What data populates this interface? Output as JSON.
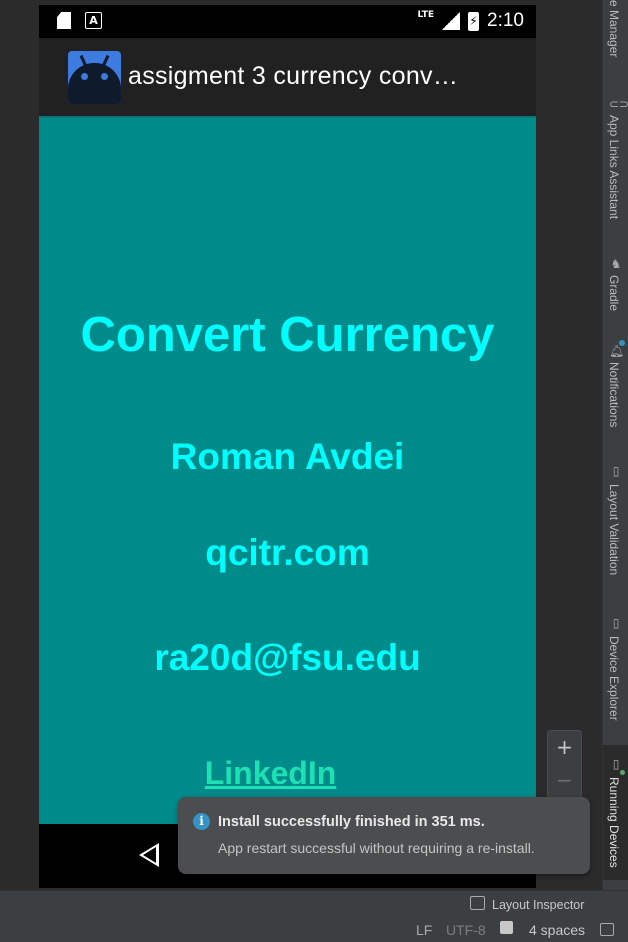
{
  "device": {
    "status_bar": {
      "network": "LTE",
      "battery_symbol": "⚡",
      "time": "2:10"
    },
    "app_bar": {
      "title": "assigment 3 currency conv…"
    },
    "content": {
      "heading": "Convert Currency",
      "name": "Roman Avdei",
      "website": "qcitr.com",
      "email": "ra20d@fsu.edu",
      "link": "LinkedIn"
    },
    "colors": {
      "content_bg": "#008b8b",
      "text": "#00ffff",
      "link": "#1de0b3"
    }
  },
  "zoom": {
    "plus": "+",
    "minus": "−"
  },
  "tool_strip": {
    "items": [
      {
        "label": "e Manager"
      },
      {
        "label": "App Links Assistant"
      },
      {
        "label": "Gradle"
      },
      {
        "label": "Notifications"
      },
      {
        "label": "Layout Validation"
      },
      {
        "label": "Device Explorer"
      },
      {
        "label": "Running Devices"
      }
    ]
  },
  "toast": {
    "icon": "i",
    "title": "Install successfully finished in 351 ms.",
    "body": "App restart successful without requiring a re-install."
  },
  "bottom": {
    "layout_inspector": "Layout Inspector",
    "line_ending": "LF",
    "encoding": "UTF-8",
    "indent": "4 spaces"
  }
}
